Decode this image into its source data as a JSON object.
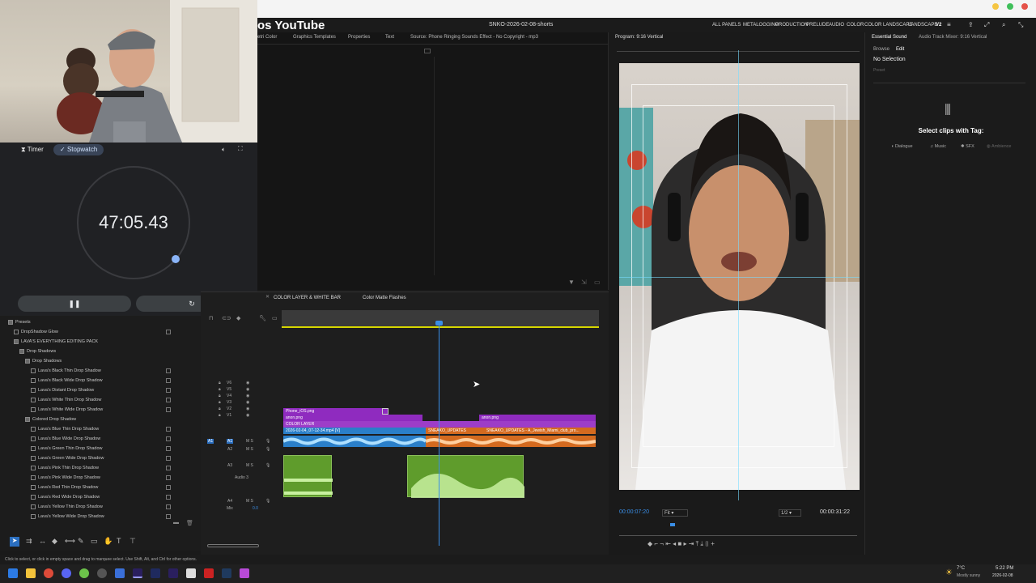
{
  "browser": {
    "title_fragment": "os YouTube"
  },
  "premiere": {
    "project": "SNKO-2026-02-08-shorts",
    "workspaces": [
      "ALL PANELS",
      "METALOGGING",
      "PRODUCTION",
      "PRELUDE",
      "AUDIO",
      "COLOR",
      "COLOR LANDSCAPE",
      "LANDSCAPE",
      "V2"
    ],
    "source_tabs": [
      "etri Color",
      "Graphics Templates",
      "Properties",
      "Text",
      "Source: Phone Ringing Sounds Effect - No Copyright - mp3"
    ],
    "program_title": "Program: 9:16 Vertical",
    "sound_tabs": [
      "Essential Sound",
      "Audio Track Mixer: 9:16 Vertical"
    ],
    "sound_subtabs": [
      "Browse",
      "Edit"
    ],
    "no_selection": "No Selection",
    "preset_label": "Preset",
    "select_clips": "Select clips with Tag:",
    "tags": [
      "Dialogue",
      "Music",
      "SFX",
      "Ambience"
    ],
    "timecode_left": "00:00:07:20",
    "fit": "Fit",
    "fraction": "1/2",
    "timecode_right": "00:00:31:22",
    "timeline_tabs": [
      "COLOR LAYER & WHITE BAR",
      "Color Matte Flashes"
    ],
    "status": "Click to select, or click in empty space and drag to marquee select. Use Shift, Alt, and Ctrl for other options."
  },
  "timer": {
    "tabs": [
      "Timer",
      "Stopwatch"
    ],
    "time": "47:05.43"
  },
  "effects": {
    "items": [
      {
        "indent": 0,
        "label": "Presets",
        "folder": true
      },
      {
        "indent": 1,
        "label": "DropShadow Glow",
        "folder": false
      },
      {
        "indent": 1,
        "label": "LAVA'S EVERYTHING EDITING PACK",
        "folder": true
      },
      {
        "indent": 2,
        "label": "Drop Shadows",
        "folder": true
      },
      {
        "indent": 3,
        "label": "Drop Shadows",
        "folder": true
      },
      {
        "indent": 4,
        "label": "Lava's Black Thin Drop Shadow",
        "folder": false
      },
      {
        "indent": 4,
        "label": "Lava's Black Wide Drop Shadow",
        "folder": false
      },
      {
        "indent": 4,
        "label": "Lava's Distant Drop Shadow",
        "folder": false
      },
      {
        "indent": 4,
        "label": "Lava's White Thin Drop Shadow",
        "folder": false
      },
      {
        "indent": 4,
        "label": "Lava's White Wide Drop Shadow",
        "folder": false
      },
      {
        "indent": 3,
        "label": "Colored Drop Shadow",
        "folder": true
      },
      {
        "indent": 4,
        "label": "Lava's Blue Thin Drop Shadow",
        "folder": false
      },
      {
        "indent": 4,
        "label": "Lava's Blue Wide Drop Shadow",
        "folder": false
      },
      {
        "indent": 4,
        "label": "Lava's Green Thin Drop Shadow",
        "folder": false
      },
      {
        "indent": 4,
        "label": "Lava's Green Wide Drop Shadow",
        "folder": false
      },
      {
        "indent": 4,
        "label": "Lava's Pink Thin Drop Shadow",
        "folder": false
      },
      {
        "indent": 4,
        "label": "Lava's Pink Wide Drop Shadow",
        "folder": false
      },
      {
        "indent": 4,
        "label": "Lava's Red Thin Drop Shadow",
        "folder": false
      },
      {
        "indent": 4,
        "label": "Lava's Red Wide Drop Shadow",
        "folder": false
      },
      {
        "indent": 4,
        "label": "Lava's Yellow Thin Drop Shadow",
        "folder": false
      },
      {
        "indent": 4,
        "label": "Lava's Yellow Wide Drop Shadow",
        "folder": false
      }
    ]
  },
  "tracks": {
    "video": [
      "V6",
      "V5",
      "V4",
      "V3",
      "V2",
      "V1"
    ],
    "audio": [
      "A1",
      "A2",
      "A3",
      "A4"
    ],
    "audio3_name": "Audio 3",
    "mix_label": "Mix",
    "mix_value": "0.0"
  },
  "clips": {
    "phone": "Phone_iOS.png",
    "anon1": "anon.png",
    "anon2": "anon.png",
    "color_layer": "COLOR LAYER",
    "main": "2026-02-04_07-12-34.mp4 [V]",
    "sneako1": "SNEAKO_UPDATES",
    "sneako2": "SNEAKO_UPDATES - A_Jewish_Miami_club_pro..."
  },
  "taskbar": {
    "weather": "7°C",
    "weather_desc": "Mostly sunny",
    "time": "5:22 PM",
    "date": "2026-02-08"
  },
  "colors": {
    "accent": "#3a8ee6",
    "purple_clip": "#8f2bbf",
    "orange_clip": "#d46a1f",
    "blue_clip": "#2a7fc9",
    "audio_clip": "#5f9c2c"
  }
}
